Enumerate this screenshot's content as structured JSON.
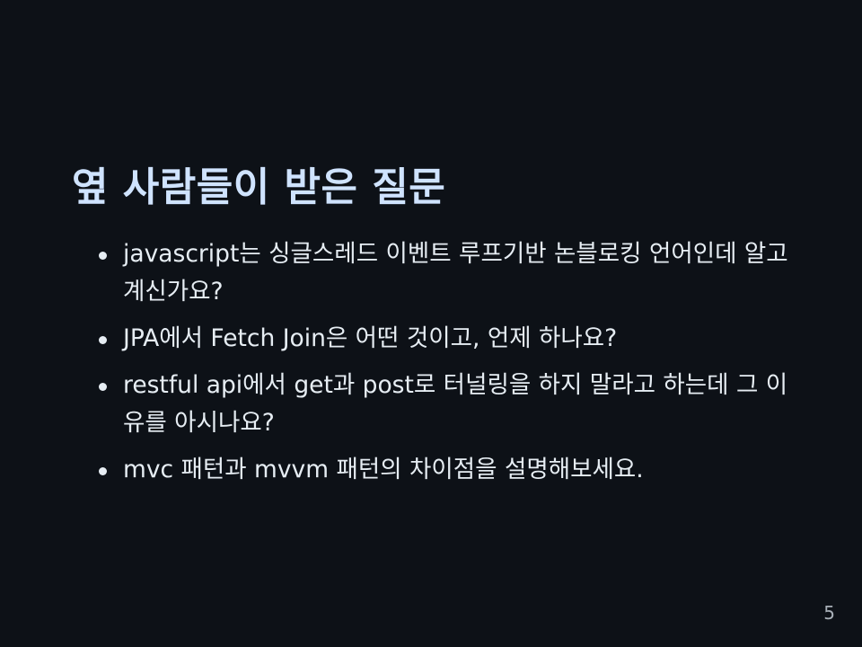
{
  "slide": {
    "title": "옆 사람들이 받은 질문",
    "bullets": [
      "javascript는 싱글스레드 이벤트 루프기반 논블로킹 언어인데 알고 계신가요?",
      "JPA에서 Fetch Join은 어떤 것이고, 언제 하나요?",
      "restful api에서 get과 post로 터널링을 하지 말라고 하는데 그 이유를 아시나요?",
      "mvc 패턴과 mvvm 패턴의 차이점을 설명해보세요."
    ],
    "page_number": "5"
  },
  "colors": {
    "background": "#0d1117",
    "title": "#cfe3ff",
    "text": "#e6edf3",
    "page_number": "#a8b0b8"
  }
}
